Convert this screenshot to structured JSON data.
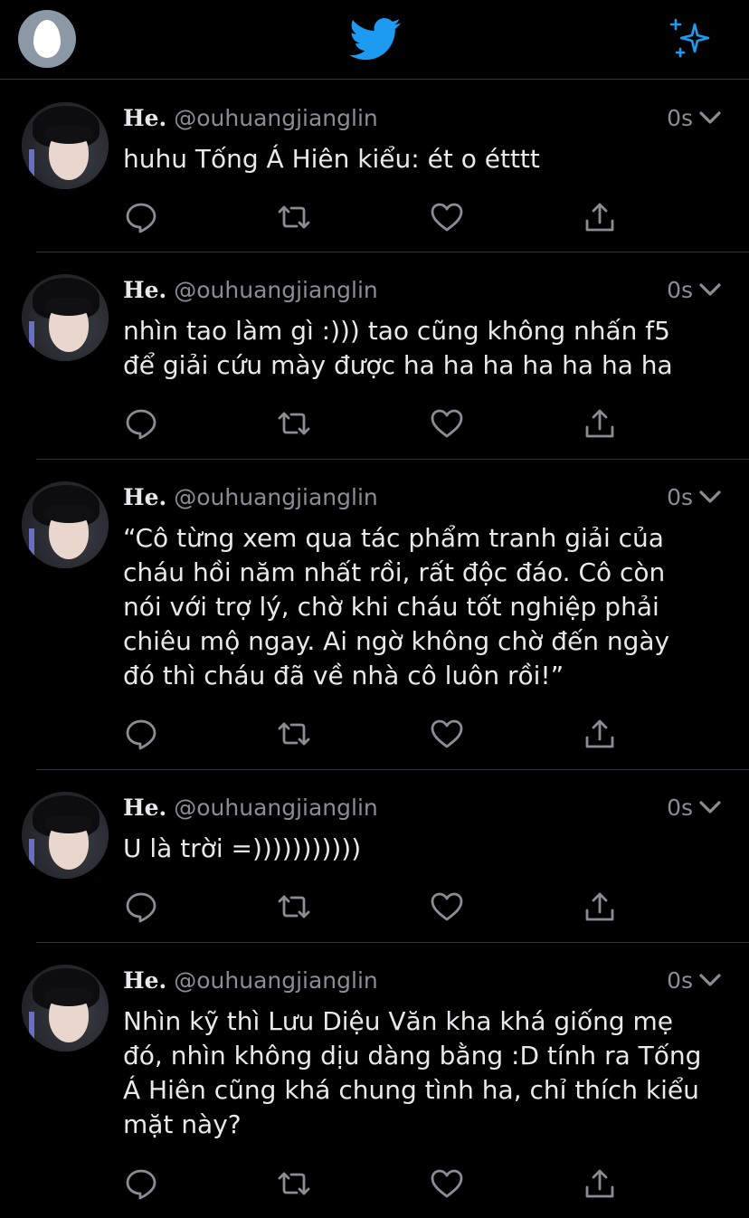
{
  "header": {
    "profile_icon": "default-egg-avatar",
    "logo_icon": "twitter-bird-icon",
    "sparkle_icon": "sparkle-icon",
    "accent": "#1d9bf0"
  },
  "tweets": [
    {
      "name": "He.",
      "handle": "@ouhuangjianglin",
      "time": "0s",
      "text": "huhu Tống Á Hiên kiểu: ét o étttt"
    },
    {
      "name": "He.",
      "handle": "@ouhuangjianglin",
      "time": "0s",
      "text": "nhìn tao làm gì :))) tao cũng không nhấn f5\nđể giải cứu mày được ha ha ha ha ha ha ha"
    },
    {
      "name": "He.",
      "handle": "@ouhuangjianglin",
      "time": "0s",
      "text": "“Cô từng xem qua tác phẩm tranh giải của\ncháu hồi năm nhất rồi, rất độc đáo. Cô còn\nnói với trợ lý, chờ khi cháu tốt nghiệp phải\nchiêu mộ ngay. Ai ngờ không chờ đến ngày\nđó thì cháu đã về nhà cô luôn rồi!”"
    },
    {
      "name": "He.",
      "handle": "@ouhuangjianglin",
      "time": "0s",
      "text": "U là trời =)))))))))))"
    },
    {
      "name": "He.",
      "handle": "@ouhuangjianglin",
      "time": "0s",
      "text": "Nhìn kỹ thì Lưu Diệu Văn kha khá giống mẹ\nđó, nhìn không dịu dàng bằng :D tính ra Tống\nÁ Hiên cũng khá chung tình ha, chỉ thích kiểu\nmặt này?"
    }
  ],
  "action_icons": [
    "reply-icon",
    "retweet-icon",
    "like-icon",
    "share-icon"
  ]
}
